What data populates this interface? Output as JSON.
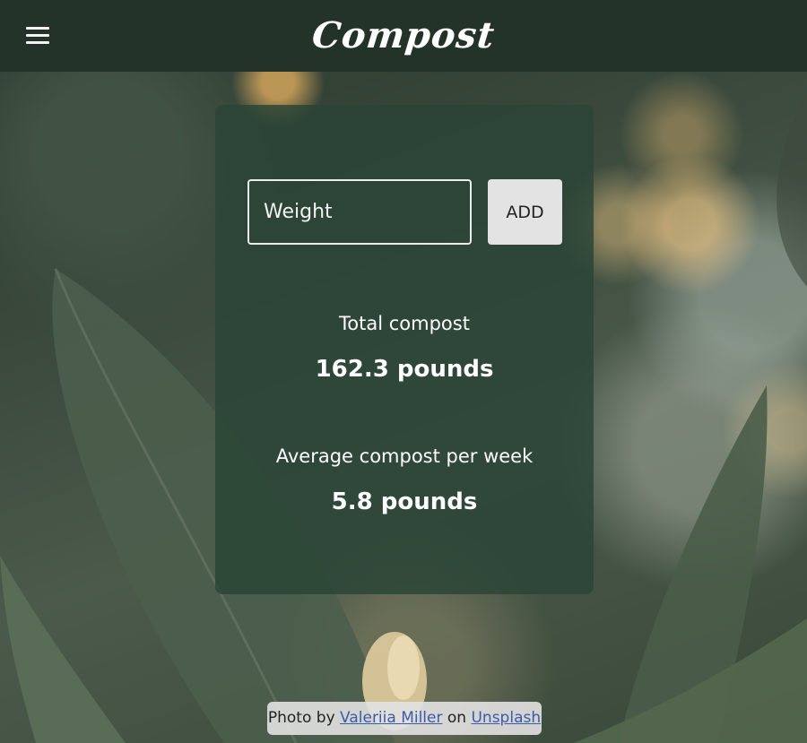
{
  "header": {
    "title": "Compost",
    "menu_icon": "hamburger-menu-icon"
  },
  "form": {
    "weight_placeholder": "Weight",
    "weight_value": "",
    "add_label": "ADD"
  },
  "stats": {
    "total_label": "Total compost",
    "total_value": "162.3 pounds",
    "average_label": "Average compost per week",
    "average_value": "5.8 pounds"
  },
  "credit": {
    "prefix": "Photo by",
    "author": "Valeriia Miller",
    "connector": "on",
    "source": "Unsplash"
  },
  "colors": {
    "header_bg": "#243329",
    "card_bg": "rgba(42, 68, 54, 0.82)",
    "button_bg": "#e3e3e3",
    "link": "#3d5ca8"
  }
}
